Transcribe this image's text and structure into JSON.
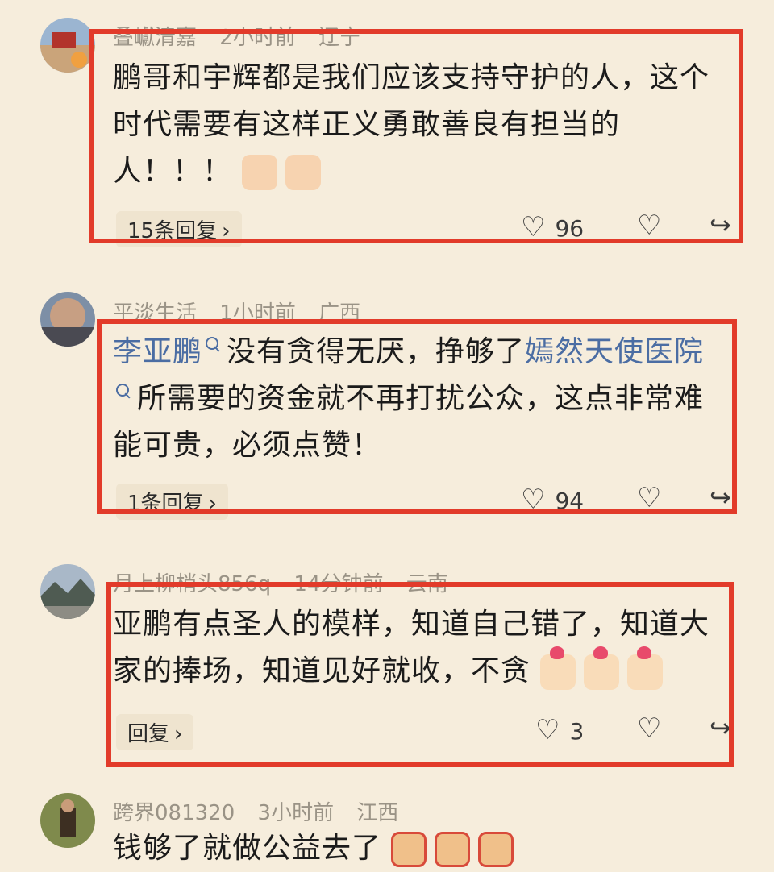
{
  "comments": [
    {
      "username": "叠巘清嘉",
      "time": "2小时前",
      "location": "辽宁",
      "text": "鹏哥和宇辉都是我们应该支持守护的人，这个时代需要有这样正义勇敢善良有担当的人！！！",
      "reply_label": "15条回复",
      "likes": "96",
      "emoji": [
        "pray",
        "pray"
      ]
    },
    {
      "username": "平淡生活",
      "time": "1小时前",
      "location": "广西",
      "text_parts": [
        {
          "type": "link",
          "text": "李亚鹏"
        },
        {
          "type": "text",
          "text": "没有贪得无厌，挣够了"
        },
        {
          "type": "link",
          "text": "嫣然天使医院"
        },
        {
          "type": "text",
          "text": "所需要的资金就不再打扰公众，这点非常难能可贵，必须点赞！"
        }
      ],
      "reply_label": "1条回复",
      "likes": "94"
    },
    {
      "username": "月上柳梢头856q",
      "time": "14分钟前",
      "location": "云南",
      "text": "亚鹏有点圣人的模样，知道自己错了，知道大家的捧场，知道见好就收，不贪",
      "reply_label": "回复",
      "likes": "3",
      "emoji": [
        "heart-hand",
        "heart-hand",
        "heart-hand"
      ]
    },
    {
      "username": "跨界081320",
      "time": "3小时前",
      "location": "江西",
      "text": "钱够了就做公益去了",
      "emoji": [
        "thumb",
        "thumb",
        "thumb"
      ]
    }
  ],
  "icons": {
    "like": "heart-outline-icon",
    "dislike": "broken-heart-icon",
    "share": "share-icon",
    "chevron": "chevron-right-icon"
  },
  "colors": {
    "highlight_box": "#e23b2a",
    "link": "#4b6da3",
    "background": "#f6eddc"
  }
}
